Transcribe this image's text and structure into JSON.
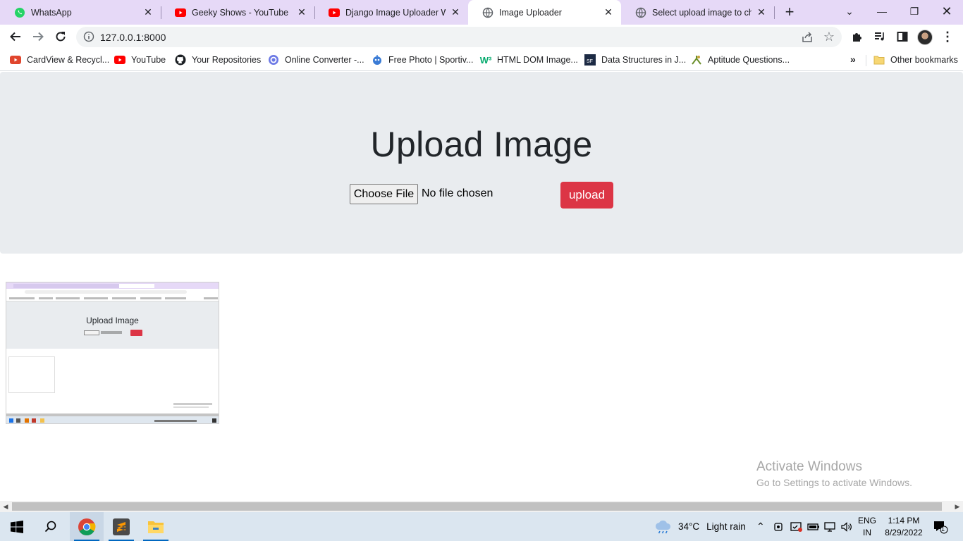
{
  "browser": {
    "tabs": [
      {
        "title": "WhatsApp",
        "icon": "whatsapp-icon"
      },
      {
        "title": "Geeky Shows - YouTube",
        "icon": "youtube-icon"
      },
      {
        "title": "Django Image Uploader Web",
        "icon": "youtube-icon"
      },
      {
        "title": "Image Uploader",
        "icon": "globe-icon"
      },
      {
        "title": "Select upload image to chan",
        "icon": "globe-icon"
      }
    ],
    "active_tab": "Image Uploader",
    "url": "127.0.0.1:8000",
    "bookmarks": [
      {
        "label": "CardView & Recycl...",
        "icon": "youtube-icon"
      },
      {
        "label": "YouTube",
        "icon": "youtube-icon"
      },
      {
        "label": "Your Repositories",
        "icon": "github-icon"
      },
      {
        "label": "Online Converter -...",
        "icon": "converter-icon"
      },
      {
        "label": "Free Photo | Sportiv...",
        "icon": "photo-icon"
      },
      {
        "label": "HTML DOM Image...",
        "icon": "w3schools-icon"
      },
      {
        "label": "Data Structures in J...",
        "icon": "ds-icon"
      },
      {
        "label": "Aptitude Questions...",
        "icon": "aptitude-icon"
      }
    ],
    "other_bookmarks": "Other bookmarks",
    "more_bookmarks": "»"
  },
  "page": {
    "heading": "Upload Image",
    "file_button": "Choose File",
    "file_status": "No file chosen",
    "upload_button": "upload",
    "thumbnail": {
      "title": "Upload Image"
    }
  },
  "watermark": {
    "line1": "Activate Windows",
    "line2": "Go to Settings to activate Windows."
  },
  "taskbar": {
    "weather": {
      "temp": "34°C",
      "condition": "Light rain"
    },
    "language": {
      "top": "ENG",
      "bottom": "IN"
    },
    "time": "1:14 PM",
    "date": "8/29/2022",
    "notifications": "1"
  },
  "colors": {
    "tabstrip": "#e6d9f7",
    "jumbotron": "#e9ecef",
    "upload_button": "#dc3545",
    "taskbar": "#dbe6f0"
  }
}
